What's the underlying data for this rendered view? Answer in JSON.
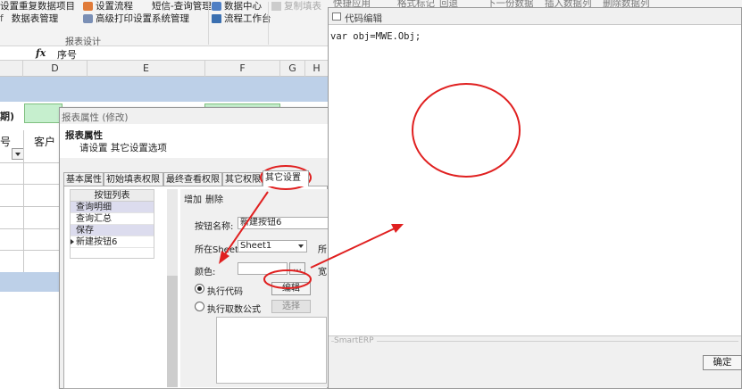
{
  "ribbon": {
    "items": [
      "设置重复数据项目",
      "数据表管理",
      "设置流程",
      "高级打印设置",
      "短信-查询管理",
      "系统管理",
      "数据中心",
      "流程工作台",
      "复制填表",
      "快捷应用",
      "格式标记",
      "回退",
      "下一份数据",
      "插入数据列",
      "删除数据列"
    ],
    "group_label": "报表设计"
  },
  "formula_bar": {
    "fx": "fx",
    "value": "序号"
  },
  "sheet": {
    "columns": [
      "D",
      "E",
      "F",
      "G",
      "H"
    ],
    "band_text": "期)",
    "header_text_1": "号",
    "header_text_2": "客户"
  },
  "report_dialog": {
    "title": "报表属性 (修改)",
    "header_title": "报表属性",
    "header_subtitle": "请设置 其它设置选项",
    "tabs": [
      "基本属性",
      "初始填表权限",
      "最终查看权限",
      "其它权限",
      "其它设置"
    ],
    "active_tab": "其它设置",
    "button_list": {
      "header": "按钮列表",
      "items": [
        "查询明细",
        "查询汇总",
        "保存",
        "新建按钮6"
      ]
    },
    "toolbar": {
      "add": "增加",
      "delete": "删除"
    },
    "form": {
      "name_label": "按钮名称:",
      "name_value": "新建按钮6",
      "sheet_label": "所在Sheet",
      "sheet_value": "Sheet1",
      "sheet_extra_label": "所",
      "color_label": "颜色:",
      "color_dots": "...",
      "color_extra_label": "宽",
      "radio_execute_code": "执行代码",
      "radio_execute_formula": "执行取数公式",
      "edit_button": "编辑",
      "select_button": "选择"
    }
  },
  "code_dialog": {
    "title": "代码编辑",
    "code": "var obj=MWE.Obj;",
    "status": "SmartERP",
    "ok_button": "确定"
  },
  "colors": {
    "annotation_red": "#e02020",
    "band_blue": "#bdd0e8",
    "cell_green": "#c6efce"
  },
  "icons": [
    "fx-icon",
    "dropdown-arrow-icon",
    "window-icon",
    "row-pointer-icon"
  ]
}
